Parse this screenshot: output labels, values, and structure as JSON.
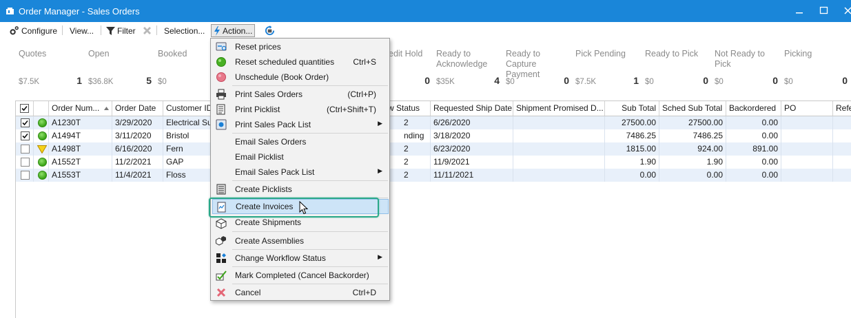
{
  "window": {
    "title": "Order Manager - Sales Orders"
  },
  "toolbar": {
    "configure": "Configure",
    "view": "View...",
    "filter": "Filter",
    "selection": "Selection...",
    "action": "Action..."
  },
  "summary": [
    {
      "label": "Quotes",
      "amount": "$7.5K",
      "count": "1"
    },
    {
      "label": "Open",
      "amount": "$36.8K",
      "count": "5"
    },
    {
      "label": "Booked",
      "amount": "$0",
      "count": ""
    },
    {
      "label": "",
      "amount": "",
      "count": ""
    },
    {
      "label": "edit Hold",
      "amount": "",
      "count": "0"
    },
    {
      "label": "Ready to Acknowledge",
      "amount": "$35K",
      "count": "4"
    },
    {
      "label": "Ready to Capture Payment",
      "amount": "$0",
      "count": "0"
    },
    {
      "label": "Pick Pending",
      "amount": "$7.5K",
      "count": "1"
    },
    {
      "label": "Ready to Pick",
      "amount": "$0",
      "count": "0"
    },
    {
      "label": "Not Ready to Pick",
      "amount": "$0",
      "count": "0"
    },
    {
      "label": "Picking",
      "amount": "$0",
      "count": "0"
    }
  ],
  "grid": {
    "headers": {
      "order_number": "Order Num...",
      "order_date": "Order Date",
      "customer_id": "Customer ID",
      "workflow_status": "w Status",
      "requested_ship_date": "Requested Ship Date",
      "shipment_promised": "Shipment Promised D...",
      "sub_total": "Sub Total",
      "sched_sub_total": "Sched Sub Total",
      "backordered": "Backordered",
      "po": "PO",
      "reference": "Refe"
    },
    "rows": [
      {
        "checked": true,
        "status": "green",
        "order": "A1230T",
        "date": "3/29/2020",
        "customer": "Electrical Sup",
        "workflow": "2",
        "ship": "6/26/2020",
        "promised": "",
        "sub": "27500.00",
        "sched": "27500.00",
        "back": "0.00",
        "po": ""
      },
      {
        "checked": true,
        "status": "green",
        "order": "A1494T",
        "date": "3/11/2020",
        "customer": "Bristol",
        "workflow": "nding",
        "ship": "3/18/2020",
        "promised": "",
        "sub": "7486.25",
        "sched": "7486.25",
        "back": "0.00",
        "po": ""
      },
      {
        "checked": false,
        "status": "yellow",
        "order": "A1498T",
        "date": "6/16/2020",
        "customer": "Fern",
        "workflow": "2",
        "ship": "6/23/2020",
        "promised": "",
        "sub": "1815.00",
        "sched": "924.00",
        "back": "891.00",
        "po": ""
      },
      {
        "checked": false,
        "status": "green",
        "order": "A1552T",
        "date": "11/2/2021",
        "customer": "GAP",
        "workflow": "2",
        "ship": "11/9/2021",
        "promised": "",
        "sub": "1.90",
        "sched": "1.90",
        "back": "0.00",
        "po": ""
      },
      {
        "checked": false,
        "status": "green",
        "order": "A1553T",
        "date": "11/4/2021",
        "customer": "Floss",
        "workflow": "2",
        "ship": "11/11/2021",
        "promised": "",
        "sub": "0.00",
        "sched": "0.00",
        "back": "0.00",
        "po": ""
      }
    ]
  },
  "menu": {
    "items": [
      {
        "label": "Reset prices",
        "shortcut": "",
        "icon": "reset-prices-icon"
      },
      {
        "label": "Reset scheduled quantities",
        "shortcut": "Ctrl+S",
        "icon": "reset-quantities-icon"
      },
      {
        "label": "Unschedule (Book Order)",
        "shortcut": "",
        "icon": "unschedule-icon"
      },
      {
        "label": "Print Sales Orders",
        "shortcut": "(Ctrl+P)",
        "icon": "printer-icon"
      },
      {
        "label": "Print Picklist",
        "shortcut": "(Ctrl+Shift+T)",
        "icon": "picklist-icon"
      },
      {
        "label": "Print Sales Pack List",
        "shortcut": "",
        "icon": "pack-list-icon"
      },
      {
        "label": "Email Sales Orders",
        "shortcut": "",
        "icon": ""
      },
      {
        "label": "Email Picklist",
        "shortcut": "",
        "icon": ""
      },
      {
        "label": "Email Sales Pack List",
        "shortcut": "",
        "icon": ""
      },
      {
        "label": "Create Picklists",
        "shortcut": "",
        "icon": "create-picklists-icon"
      },
      {
        "label": "Create Invoices",
        "shortcut": "",
        "icon": "invoice-icon"
      },
      {
        "label": "Create Shipments",
        "shortcut": "",
        "icon": "shipment-icon"
      },
      {
        "label": "Create Assemblies",
        "shortcut": "",
        "icon": "assembly-icon"
      },
      {
        "label": "Change Workflow Status",
        "shortcut": "",
        "icon": "workflow-icon"
      },
      {
        "label": "Mark Completed (Cancel Backorder)",
        "shortcut": "",
        "icon": "mark-completed-icon"
      },
      {
        "label": "Cancel",
        "shortcut": "Ctrl+D",
        "icon": "cancel-icon"
      }
    ]
  },
  "colors": {
    "titlebar": "#1a86d9",
    "highlight": "#2aa889",
    "selected_row": "#e8f0fa"
  }
}
